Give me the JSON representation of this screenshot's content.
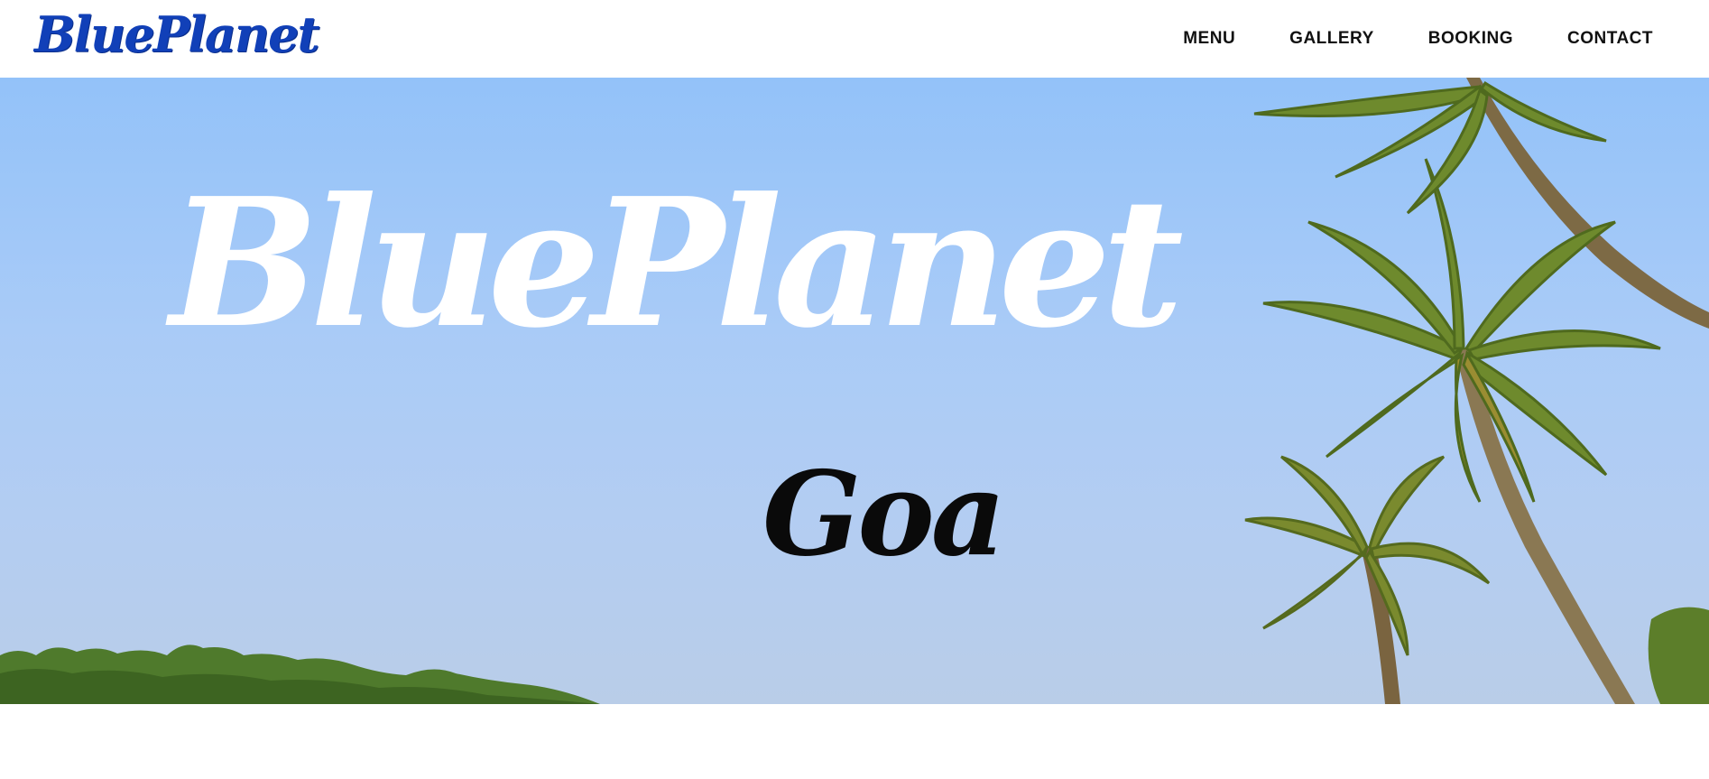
{
  "brand": {
    "logo_text": "BluePlanet",
    "color": "#1140b8"
  },
  "nav": {
    "items": [
      {
        "label": "MENU"
      },
      {
        "label": "GALLERY"
      },
      {
        "label": "BOOKING"
      },
      {
        "label": "CONTACT"
      }
    ]
  },
  "hero": {
    "title": "BluePlanet",
    "subtitle": "Goa",
    "sky_color": "#a9cbf7"
  }
}
